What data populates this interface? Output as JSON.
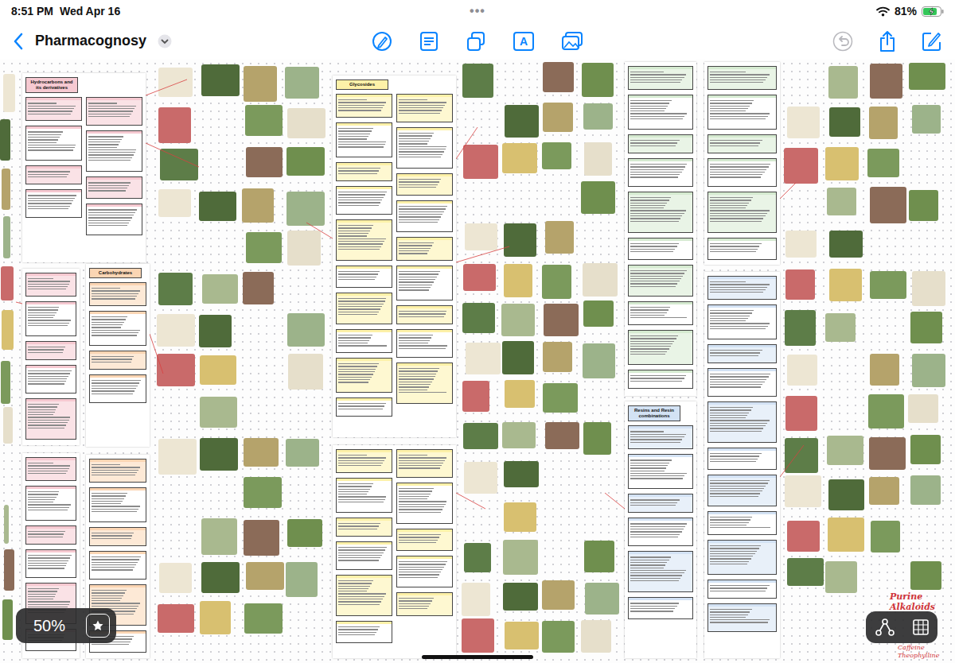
{
  "status_bar": {
    "time": "8:51 PM",
    "date": "Wed Apr 16",
    "dots": "•••",
    "battery": "81%",
    "battery_level": 0.81,
    "charging": true
  },
  "toolbar": {
    "title": "Pharmacognosy",
    "text_tool_glyph": "A",
    "undo_disabled": true
  },
  "zoom": {
    "label": "50%"
  },
  "notes": [
    {
      "heading": "Hydrocarbons and its derivatives",
      "color": "#f6c9d1"
    },
    {
      "color": "#f6c9d1"
    },
    {
      "heading": "Carbohydrates",
      "color": "#fbd5b3"
    },
    {
      "color": "#f6c9d1"
    },
    {
      "color": "#fbd5b3"
    },
    {
      "heading": "Glycosides",
      "color": "#fdf1a8"
    },
    {
      "color": "#fdf1a8"
    },
    {
      "color": "#d5ead0"
    },
    {
      "color": "#d5ead0"
    },
    {
      "heading": "Resins and Resin combinations",
      "color": "#d3e2f4"
    },
    {
      "color": "#d3e2f4"
    }
  ],
  "handwriting": [
    "Purine Alkaloids",
    "Caffeine",
    "Theophylline"
  ]
}
